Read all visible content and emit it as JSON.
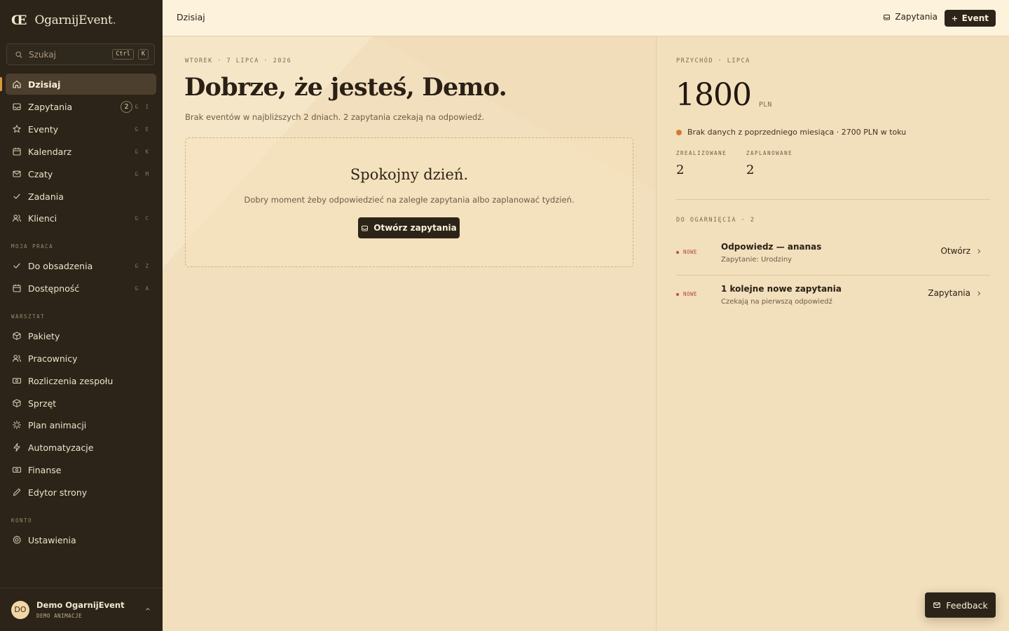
{
  "brand": {
    "logo": "Œ",
    "name": "OgarnijEvent",
    "dot": "."
  },
  "search": {
    "label": "Szukaj",
    "key1": "Ctrl",
    "key2": "K"
  },
  "nav": {
    "main": [
      {
        "label": "Dzisiaj",
        "shortcut": "",
        "icon": "home-icon"
      },
      {
        "label": "Zapytania",
        "shortcut": "G I",
        "badge": "2",
        "icon": "inbox-icon"
      },
      {
        "label": "Eventy",
        "shortcut": "G E",
        "icon": "star-icon"
      },
      {
        "label": "Kalendarz",
        "shortcut": "G K",
        "icon": "calendar-icon"
      },
      {
        "label": "Czaty",
        "shortcut": "G M",
        "icon": "mail-icon"
      },
      {
        "label": "Zadania",
        "shortcut": "",
        "icon": "check-icon"
      },
      {
        "label": "Klienci",
        "shortcut": "G C",
        "icon": "users-icon"
      }
    ],
    "work_section": "MOJA PRACA",
    "work": [
      {
        "label": "Do obsadzenia",
        "shortcut": "G Z",
        "icon": "check-icon"
      },
      {
        "label": "Dostępność",
        "shortcut": "G A",
        "icon": "calendar-icon"
      }
    ],
    "shop_section": "WARSZTAT",
    "shop": [
      {
        "label": "Pakiety",
        "icon": "package-icon"
      },
      {
        "label": "Pracownicy",
        "icon": "users-icon"
      },
      {
        "label": "Rozliczenia zespołu",
        "icon": "banknote-icon"
      },
      {
        "label": "Sprzęt",
        "icon": "package-icon"
      },
      {
        "label": "Plan animacji",
        "icon": "sparkle-icon"
      },
      {
        "label": "Automatyzacje",
        "icon": "bolt-icon"
      },
      {
        "label": "Finanse",
        "icon": "banknote-icon"
      },
      {
        "label": "Edytor strony",
        "icon": "pencil-icon"
      }
    ],
    "account_section": "KONTO",
    "account": [
      {
        "label": "Ustawienia",
        "icon": "gear-icon"
      }
    ]
  },
  "user": {
    "initials": "DO",
    "name": "Demo OgarnijEvent",
    "role": "DEMO ANIMACJE"
  },
  "topbar": {
    "title": "Dzisiaj",
    "inquiries": "Zapytania",
    "new_event": "Event"
  },
  "main": {
    "date": "WTOREK · 7 LIPCA · 2026",
    "greeting": "Dobrze, że jesteś, Demo.",
    "summary": "Brak eventów w najbliższych 2 dniach. 2 zapytania czekają na odpowiedź.",
    "calm_title": "Spokojny dzień.",
    "calm_text": "Dobry moment żeby odpowiedzieć na zaległe zapytania albo zaplanować tydzień.",
    "calm_button": "Otwórz zapytania"
  },
  "revenue": {
    "label": "PRZYCHÓD · LIPCA",
    "amount": "1800",
    "currency": "PLN",
    "note": "Brak danych z poprzedniego miesiąca · 2700 PLN w toku",
    "done_label": "ZREALIZOWANE",
    "done_value": "2",
    "planned_label": "ZAPLANOWANE",
    "planned_value": "2"
  },
  "todo": {
    "label": "DO OGARNIĘCIA · 2",
    "items": [
      {
        "badge": "NOWE",
        "title": "Odpowiedz — ananas",
        "subtitle": "Zapytanie: Urodziny",
        "action": "Otwórz"
      },
      {
        "badge": "NOWE",
        "title": "1 kolejne nowe zapytania",
        "subtitle": "Czekają na pierwszą odpowiedź",
        "action": "Zapytania"
      }
    ]
  },
  "feedback": {
    "label": "Feedback"
  },
  "colors": {
    "sidebar": "#2c2418",
    "accent": "#d89a3a",
    "background": "#f2dfbd",
    "badge_new": "#b04a34",
    "revenue_dot": "#cf7d2c"
  }
}
